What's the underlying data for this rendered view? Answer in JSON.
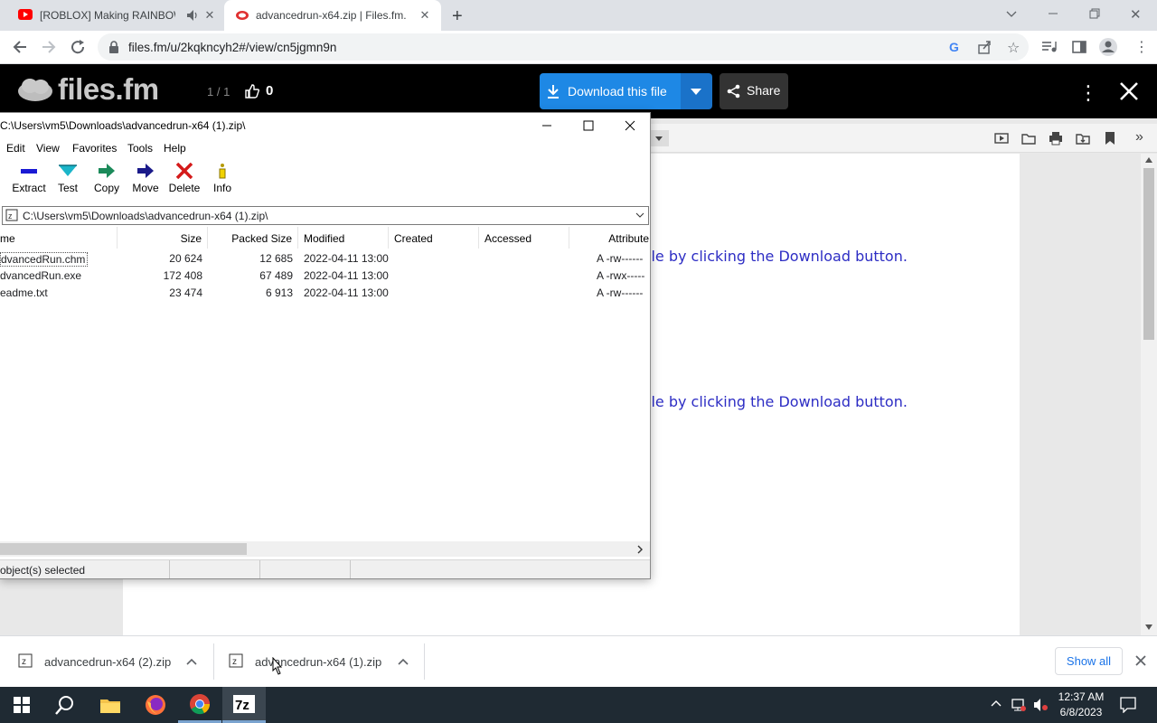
{
  "browser": {
    "tabs": [
      {
        "title": "[ROBLOX] Making RAINBOW",
        "icon": "youtube-icon"
      },
      {
        "title": "advancedrun-x64.zip | Files.fm.",
        "icon": "filesfm-icon"
      }
    ],
    "url": "files.fm/u/2kqkncyh2#/view/cn5jgmn9n"
  },
  "filesfm": {
    "logo": "files.fm",
    "page_count": "1 / 1",
    "likes": "0",
    "download_label": "Download this file",
    "share_label": "Share",
    "doc_lines": [
      "ile by clicking the Download button.",
      "ile by clicking the Download button."
    ]
  },
  "zip": {
    "title": "C:\\Users\\vm5\\Downloads\\advancedrun-x64 (1).zip\\",
    "menu": [
      "Edit",
      "View",
      "Favorites",
      "Tools",
      "Help"
    ],
    "tools": [
      {
        "label": "Extract",
        "icon": "extract-icon",
        "color": "#1a1ad4"
      },
      {
        "label": "Test",
        "icon": "test-icon",
        "color": "#1bb5c9"
      },
      {
        "label": "Copy",
        "icon": "copy-icon",
        "color": "#1b8a5a"
      },
      {
        "label": "Move",
        "icon": "move-icon",
        "color": "#1a1a8a"
      },
      {
        "label": "Delete",
        "icon": "delete-icon",
        "color": "#d41a1a"
      },
      {
        "label": "Info",
        "icon": "info-icon",
        "color": "#b59a00"
      }
    ],
    "path": "C:\\Users\\vm5\\Downloads\\advancedrun-x64 (1).zip\\",
    "columns": [
      "me",
      "Size",
      "Packed Size",
      "Modified",
      "Created",
      "Accessed",
      "Attribute"
    ],
    "rows": [
      {
        "name": "dvancedRun.chm",
        "size": "20 624",
        "packed": "12 685",
        "modified": "2022-04-11 13:00",
        "created": "",
        "accessed": "",
        "attr": "A -rw------"
      },
      {
        "name": "dvancedRun.exe",
        "size": "172 408",
        "packed": "67 489",
        "modified": "2022-04-11 13:00",
        "created": "",
        "accessed": "",
        "attr": "A -rwx-----"
      },
      {
        "name": "eadme.txt",
        "size": "23 474",
        "packed": "6 913",
        "modified": "2022-04-11 13:00",
        "created": "",
        "accessed": "",
        "attr": "A -rw------"
      }
    ],
    "status": "object(s) selected"
  },
  "downloads": {
    "items": [
      "advancedrun-x64 (2).zip",
      "advancedrun-x64 (1).zip"
    ],
    "show_all": "Show all"
  },
  "taskbar": {
    "time": "12:37 AM",
    "date": "6/8/2023"
  }
}
